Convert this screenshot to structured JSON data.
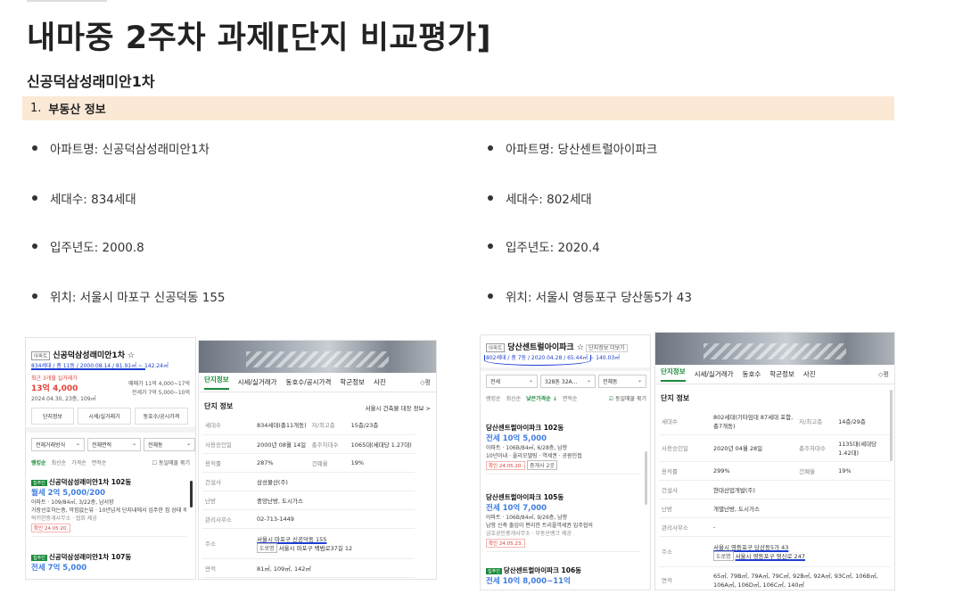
{
  "page": {
    "title": "내마중 2주차 과제[단지 비교평가]",
    "section_title": "신공덕삼성래미안1차",
    "callout_num": "1.",
    "callout_text": "부동산 정보"
  },
  "left_bullets": [
    "아파트명: 신공덕삼성래미안1차",
    "세대수: 834세대",
    "입주년도: 2000.8",
    "위치: 서울시 마포구 신공덕동 155"
  ],
  "right_bullets": [
    "아파트명: 당산센트럴아이파크",
    "세대수: 802세대",
    "입주년도: 2020.4",
    "위치: 서울시 영등포구 당산동5가 43"
  ],
  "left_card": {
    "badge": "아파트",
    "name": "신공덕삼성래미안1차 ☆",
    "meta": "834세대 / 총 11동 / 2000.08.14 / 81.91㎡ ~ 142.24㎡",
    "recent_label": "최근 3개월 실거래가",
    "recent_price": "13억 4,000",
    "recent_meta": "2024.04.30, 23층, 109㎡",
    "trade_label": "매매가 11억 4,000~17억",
    "rent_label": "전세가 7억 5,000~10억",
    "buttons": [
      "단지정보",
      "시세/실거래가",
      "동호수/공시가격"
    ],
    "filters": [
      "전체거래방식",
      "전체면적",
      "전체동"
    ],
    "chips": [
      "랭킹순",
      "최신순",
      "가격순",
      "면적순"
    ],
    "same_listing": "동일매물 묶기",
    "listings": [
      {
        "badge": "집주인",
        "name": "신공덕삼성래미안1차 102동",
        "price": "월세 2억 5,000/200",
        "desc": "아파트 · 109/84㎡, 3/22층, 남서향",
        "extra": "가장선호하는층, 막힘없는뷰 · 10년넘게 단지내에서 입주한 집 상태 깨끗함",
        "agent": "럭키한중개사무소 · 협회 제공",
        "date": "확인 24.05.20."
      },
      {
        "badge": "집주인",
        "name": "신공덕삼성래미안1차 107동",
        "price": "전세 7억 5,000"
      }
    ]
  },
  "left_detail": {
    "tabs": [
      "단지정보",
      "시세/실거래가",
      "동호수/공시가격",
      "학군정보",
      "사진"
    ],
    "more": "◇평",
    "head": "단지 정보",
    "link": "서울시 건축물 대장 정보 >",
    "rows": [
      {
        "k": "세대수",
        "v": "834세대(총11개동)",
        "k2": "저/최고층",
        "v2": "15층/23층"
      },
      {
        "k": "사용승인일",
        "v": "2000년 08월 14일",
        "k2": "총주차대수",
        "v2": "1065대(세대당 1.27대)"
      },
      {
        "k": "용적률",
        "v": "287%",
        "k2": "건폐율",
        "v2": "19%"
      },
      {
        "k": "건설사",
        "v": "삼성물산(주)",
        "k2": "",
        "v2": ""
      },
      {
        "k": "난방",
        "v": "중앙난방, 도시가스",
        "k2": "",
        "v2": ""
      },
      {
        "k": "관리사무소",
        "v": "02-713-1449",
        "k2": "",
        "v2": ""
      },
      {
        "k": "주소",
        "v": "서울시 마포구 신공덕동 155",
        "tag": "도로명",
        "v_extra": "서울시 마포구 백범로37길 12",
        "k2": "",
        "v2": ""
      },
      {
        "k": "면적",
        "v": "81㎡, 109㎡, 142㎡",
        "k2": "",
        "v2": ""
      }
    ]
  },
  "right_card": {
    "badge": "아파트",
    "name": "당산센트럴아이파크 ☆",
    "note": "단지정보 더보기",
    "meta": "802세대 / 총 7동 / 2020.04.28 / 65.44㎡ ~ 140.03㎡",
    "filters": [
      "전세",
      "328톤 32A...",
      "전체동"
    ],
    "chips": [
      "랭킹순",
      "최신순",
      "낮은가격순 ↓",
      "면적순"
    ],
    "same_listing": "동일매물 묶기",
    "listings": [
      {
        "name": "당산센트럴아이파크 102동",
        "price": "전세 10억 5,000",
        "desc": "아파트 · 106B/84㎡, 6/28층, 남향",
        "extra": "10년이내 · 올리모델링 · 역세권 · 공원인접",
        "date": "확인 24.05.20.",
        "extra2": "중개사 2곳"
      },
      {
        "name": "당산센트럴아이파크 105동",
        "price": "전세 10억 7,000",
        "desc": "아파트 · 106B/84㎡, 9/26층, 남향",
        "extra": "남향 신축 출입이 편리한 트리플역세권 입주협의",
        "agent": "금호공인중개사무소 · 부동산뱅크 제공",
        "date": "확인 24.05.23."
      },
      {
        "badge": "집주인",
        "name": "당산센트럴아이파크 106동",
        "price": "전세 10억 8,000~11억"
      }
    ]
  },
  "right_detail": {
    "tabs": [
      "단지정보",
      "시세/실거래가",
      "동호수",
      "학군정보",
      "사진"
    ],
    "more": "◇평",
    "head": "단지 정보",
    "rows": [
      {
        "k": "세대수",
        "v": "802세대(기타임대 87세대 포함, 총7개동)",
        "k2": "저/최고층",
        "v2": "14층/29층"
      },
      {
        "k": "사용승인일",
        "v": "2020년 04월 28일",
        "k2": "총주차대수",
        "v2": "1135대(세대당 1.42대)"
      },
      {
        "k": "용적률",
        "v": "299%",
        "k2": "건폐율",
        "v2": "19%"
      },
      {
        "k": "건설사",
        "v": "현대산업개발(주)",
        "k2": "",
        "v2": ""
      },
      {
        "k": "난방",
        "v": "개별난방, 도시가스",
        "k2": "",
        "v2": ""
      },
      {
        "k": "관리사무소",
        "v": "-",
        "k2": "",
        "v2": ""
      },
      {
        "k": "주소",
        "v": "서울시 영등포구 당산동5가 43",
        "tag": "도로명",
        "v_extra": "서울시 영등포구 영신로 247",
        "k2": "",
        "v2": ""
      },
      {
        "k": "면적",
        "v": "65㎡, 79B㎡, 79A㎡, 79C㎡, 92B㎡, 92A㎡, 93C㎡, 106B㎡, 106A㎡, 106D㎡, 106C㎡, 140㎡",
        "k2": "",
        "v2": ""
      }
    ]
  },
  "colors": {
    "callout_bg": "#fbe9d6",
    "accent_green": "#1a8a3a",
    "price_red": "#e0423a",
    "price_blue": "#3f7de0",
    "annotation_blue": "#1d3fd1"
  }
}
